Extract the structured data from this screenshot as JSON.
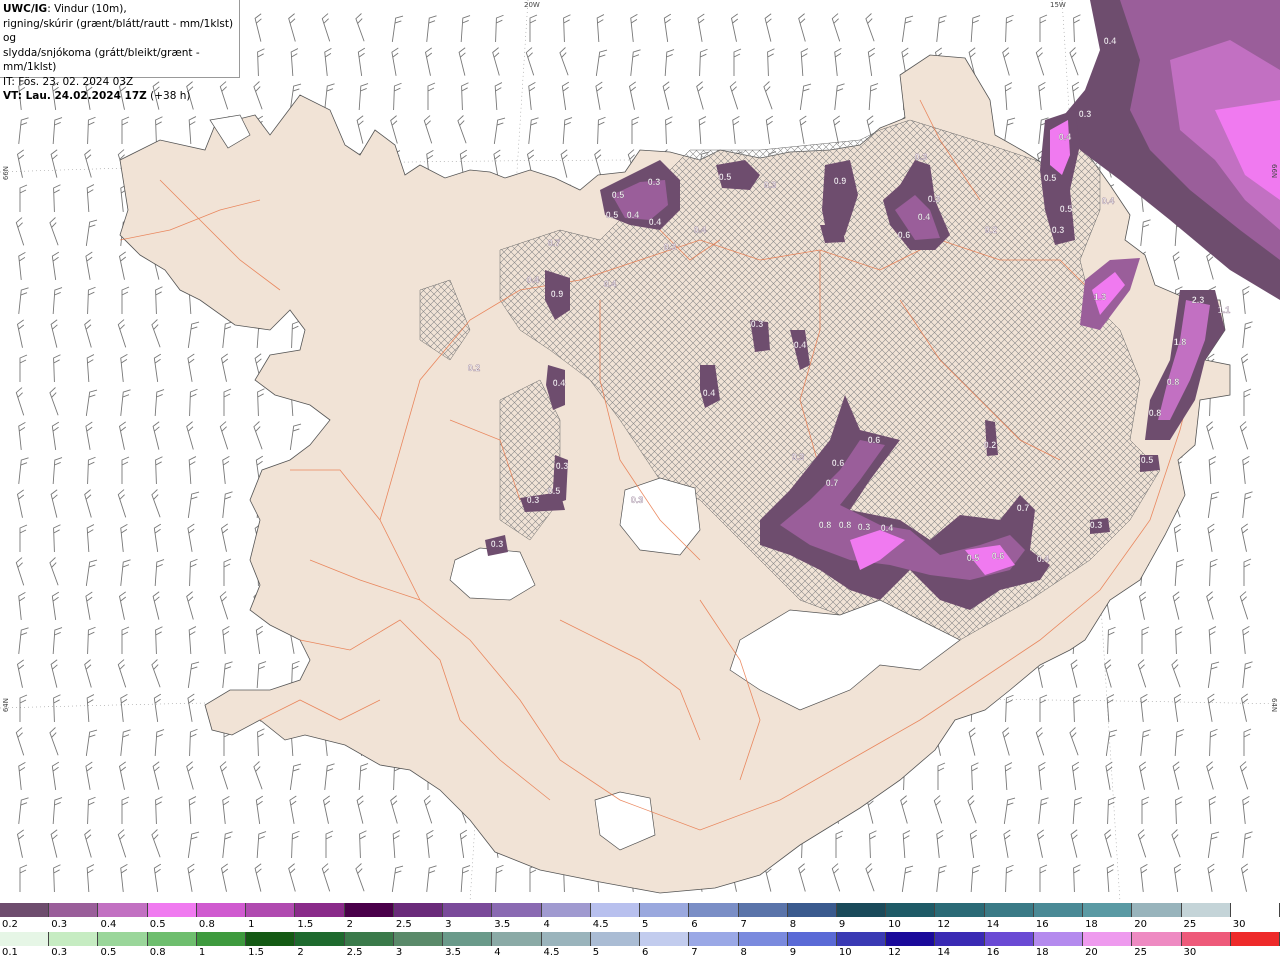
{
  "title": {
    "product": "UWC/IG",
    "line1_rest": ": Vindur (10m),",
    "line2": "rigning/skúrir (grænt/blátt/rautt - mm/1klst) og",
    "line3": "slydda/snjókoma (grátt/bleikt/grænt - mm/1klst)",
    "line4": "IT: Fös. 23. 02. 2024 03Z",
    "line5_bold": "VT: Lau. 24.02.2024 17Z",
    "line5_rest": " (+38 h)"
  },
  "grid_labels": {
    "top_20w": "20W",
    "top_15w": "15W",
    "left_66n": "66N",
    "left_64n": "64N",
    "right_66n": "66N",
    "right_64n": "64N"
  },
  "colors": {
    "land": "#f1e3d6",
    "roads": "#e8784a",
    "glacier": "#ffffff",
    "sea": "#ffffff",
    "coast": "#555555"
  },
  "precip_labels": [
    "0.4",
    "0.3",
    "0.4",
    "0.5",
    "0.5",
    "0.4",
    "0.3",
    "0.5",
    "0.3",
    "0.5",
    "0.5",
    "0.9",
    "0.3",
    "0.4",
    "0.3",
    "0.6",
    "0.2",
    "0.4",
    "0.4",
    "0.4",
    "0.2",
    "0.7",
    "0.4",
    "0.9",
    "0.3",
    "0.4",
    "0.3",
    "0.4",
    "0.4",
    "0.3",
    "0.4",
    "1.3",
    "2.3",
    "1.1",
    "1.8",
    "0.8",
    "0.8",
    "0.5",
    "0.3",
    "0.5",
    "0.6",
    "0.6",
    "0.7",
    "0.3",
    "0.8",
    "0.8",
    "0.3",
    "0.4",
    "0.7",
    "0.5",
    "0.6",
    "0.4",
    "0.3",
    "0.3",
    "0.3",
    "0.2",
    "0.3"
  ],
  "legend_snow": {
    "colors": [
      "#6e4d6e",
      "#9a5e9a",
      "#c270c2",
      "#f07af0",
      "#d05ad0",
      "#b04ab0",
      "#8a2a8a",
      "#4a004a",
      "#6a2a7a",
      "#7a4a9a",
      "#8a6ab2",
      "#a09ad0",
      "#b8c0ee",
      "#9aa8de",
      "#7a8ec6",
      "#5a74aa",
      "#3a5a8e",
      "#1a4a5a",
      "#1e5a66",
      "#2a6a76",
      "#3a7a86",
      "#4a8a96",
      "#5a9aa4",
      "#98b4bc",
      "#c4d4d8",
      "#ffffff"
    ],
    "labels": [
      "0.2",
      "0.3",
      "0.4",
      "0.5",
      "0.8",
      "1",
      "1.5",
      "2",
      "2.5",
      "3",
      "3.5",
      "4",
      "4.5",
      "5",
      "6",
      "7",
      "8",
      "9",
      "10",
      "12",
      "14",
      "16",
      "18",
      "20",
      "25",
      "30"
    ]
  },
  "legend_rain": {
    "colors": [
      "#e6f6e6",
      "#c6ecc2",
      "#9ad69a",
      "#6ebe6e",
      "#3e9a3e",
      "#145a14",
      "#1e6a2e",
      "#3a7a4a",
      "#5a8a6a",
      "#6a9a8a",
      "#8aaaa6",
      "#9ab4bc",
      "#aabcd4",
      "#c2ccee",
      "#9aa8e6",
      "#7a8ade",
      "#5a6ad6",
      "#3a3ab4",
      "#1a0a9a",
      "#3a2ab4",
      "#6a4ad4",
      "#b48aee",
      "#ee9aee",
      "#ee8ac2",
      "#ee5a7a",
      "#ee2a2a"
    ],
    "labels": [
      "0.1",
      "0.3",
      "0.5",
      "0.8",
      "1",
      "1.5",
      "2",
      "2.5",
      "3",
      "3.5",
      "4",
      "4.5",
      "5",
      "6",
      "7",
      "8",
      "9",
      "10",
      "12",
      "14",
      "16",
      "18",
      "20",
      "25",
      "30"
    ]
  }
}
